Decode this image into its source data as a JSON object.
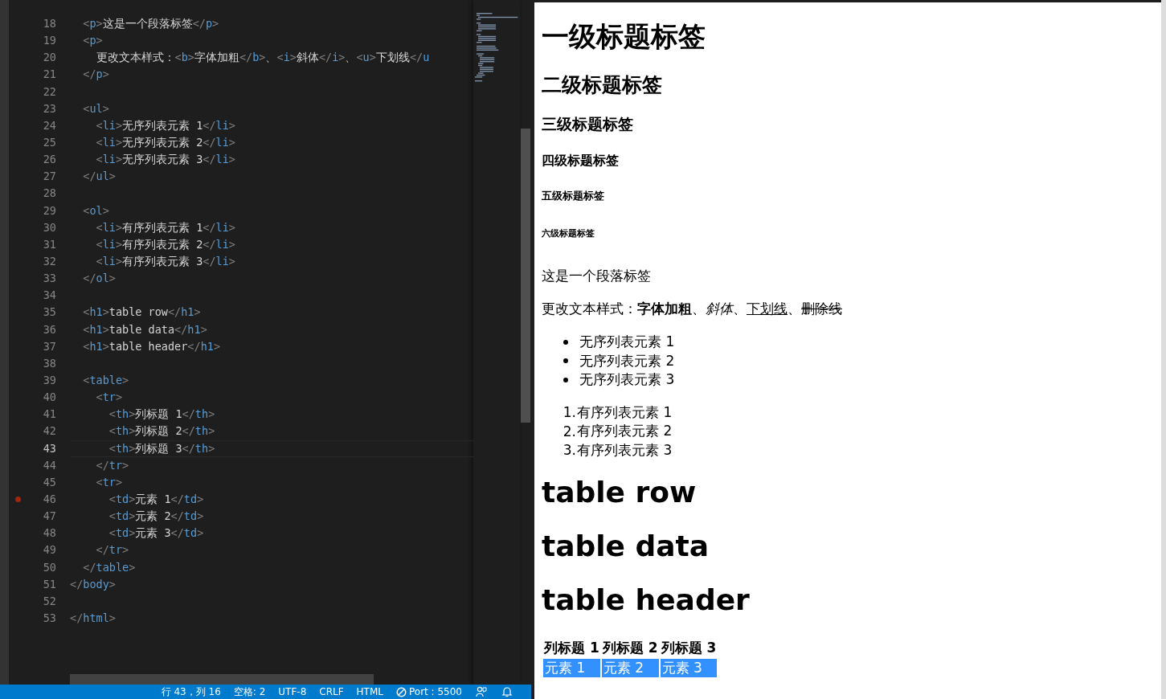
{
  "editor": {
    "lines": [
      {
        "number": "18",
        "code": "  <p>这是一个段落标签</p>",
        "current": false,
        "breakpoint": false
      },
      {
        "number": "19",
        "code": "  <p>",
        "current": false,
        "breakpoint": false
      },
      {
        "number": "20",
        "code": "    更改文本样式：<b>字体加粗</b>、<i>斜体</i>、<u>下划线</u",
        "current": false,
        "breakpoint": false
      },
      {
        "number": "21",
        "code": "  </p>",
        "current": false,
        "breakpoint": false
      },
      {
        "number": "22",
        "current": false,
        "breakpoint": false
      },
      {
        "number": "23",
        "code": "  <ul>",
        "current": false,
        "breakpoint": false
      },
      {
        "number": "24",
        "code": "    <li>无序列表元素 1</li>",
        "current": false,
        "breakpoint": false
      },
      {
        "number": "25",
        "code": "    <li>无序列表元素 2</li>",
        "current": false,
        "breakpoint": false
      },
      {
        "number": "26",
        "code": "    <li>无序列表元素 3</li>",
        "current": false,
        "breakpoint": false
      },
      {
        "number": "27",
        "code": "  </ul>",
        "current": false,
        "breakpoint": false
      },
      {
        "number": "28",
        "current": false,
        "breakpoint": false
      },
      {
        "number": "29",
        "code": "  <ol>",
        "current": false,
        "breakpoint": false
      },
      {
        "number": "30",
        "code": "    <li>有序列表元素 1</li>",
        "current": false,
        "breakpoint": false
      },
      {
        "number": "31",
        "code": "    <li>有序列表元素 2</li>",
        "current": false,
        "breakpoint": false
      },
      {
        "number": "32",
        "code": "    <li>有序列表元素 3</li>",
        "current": false,
        "breakpoint": false
      },
      {
        "number": "33",
        "code": "  </ol>",
        "current": false,
        "breakpoint": false
      },
      {
        "number": "34",
        "current": false,
        "breakpoint": false
      },
      {
        "number": "35",
        "code": "  <h1>table row</h1>",
        "current": false,
        "breakpoint": false
      },
      {
        "number": "36",
        "code": "  <h1>table data</h1>",
        "current": false,
        "breakpoint": false
      },
      {
        "number": "37",
        "code": "  <h1>table header</h1>",
        "current": false,
        "breakpoint": false
      },
      {
        "number": "38",
        "current": false,
        "breakpoint": false
      },
      {
        "number": "39",
        "code": "  <table>",
        "current": false,
        "breakpoint": false
      },
      {
        "number": "40",
        "code": "    <tr>",
        "current": false,
        "breakpoint": false
      },
      {
        "number": "41",
        "code": "      <th>列标题 1</th>",
        "current": false,
        "breakpoint": false
      },
      {
        "number": "42",
        "code": "      <th>列标题 2</th>",
        "current": false,
        "breakpoint": false
      },
      {
        "number": "43",
        "code": "      <th>列标题 3</th>",
        "current": true,
        "breakpoint": false
      },
      {
        "number": "44",
        "code": "    </tr>",
        "current": false,
        "breakpoint": false
      },
      {
        "number": "45",
        "code": "    <tr>",
        "current": false,
        "breakpoint": false
      },
      {
        "number": "46",
        "code": "      <td>元素 1</td>",
        "current": false,
        "breakpoint": true
      },
      {
        "number": "47",
        "code": "      <td>元素 2</td>",
        "current": false,
        "breakpoint": false
      },
      {
        "number": "48",
        "code": "      <td>元素 3</td>",
        "current": false,
        "breakpoint": false
      },
      {
        "number": "49",
        "code": "    </tr>",
        "current": false,
        "breakpoint": false
      },
      {
        "number": "50",
        "code": "  </table>",
        "current": false,
        "breakpoint": false
      },
      {
        "number": "51",
        "code": "</body>",
        "current": false,
        "breakpoint": false
      },
      {
        "number": "52",
        "current": false,
        "breakpoint": false
      },
      {
        "number": "53",
        "code": "</html>",
        "current": false,
        "breakpoint": false
      }
    ]
  },
  "status_bar": {
    "items": [
      {
        "kind": "text",
        "text": "行 43，列 16"
      },
      {
        "kind": "text",
        "text": "空格: 2"
      },
      {
        "kind": "text",
        "text": "UTF-8"
      },
      {
        "kind": "text",
        "text": "CRLF"
      },
      {
        "kind": "text",
        "text": "HTML"
      },
      {
        "kind": "port",
        "text": "Port : 5500"
      },
      {
        "kind": "feedback"
      },
      {
        "kind": "bell"
      }
    ]
  },
  "preview": {
    "blocks": [
      {
        "kind": "h1",
        "text": "一级标题标签"
      },
      {
        "kind": "h2",
        "text": "二级标题标签"
      },
      {
        "kind": "h3",
        "text": "三级标题标签"
      },
      {
        "kind": "h4",
        "text": "四级标题标签"
      },
      {
        "kind": "h5",
        "text": "五级标题标签"
      },
      {
        "kind": "h6",
        "text": "六级标题标签"
      },
      {
        "kind": "p",
        "text": "这是一个段落标签"
      },
      {
        "kind": "styled",
        "parts": [
          {
            "kind": "plain",
            "text": "更改文本样式："
          },
          {
            "kind": "bold",
            "text": "字体加粗"
          },
          {
            "kind": "plain",
            "text": "、"
          },
          {
            "kind": "italic",
            "text": "斜体"
          },
          {
            "kind": "plain",
            "text": "、"
          },
          {
            "kind": "underline",
            "text": "下划线"
          },
          {
            "kind": "plain",
            "text": "、"
          },
          {
            "kind": "strike",
            "text": "删除线"
          }
        ]
      },
      {
        "kind": "ul",
        "items": [
          "无序列表元素 1",
          "无序列表元素 2",
          "无序列表元素 3"
        ]
      },
      {
        "kind": "ol",
        "items": [
          {
            "marker": "1.",
            "text": "有序列表元素 1"
          },
          {
            "marker": "2.",
            "text": "有序列表元素 2"
          },
          {
            "marker": "3.",
            "text": "有序列表元素 3"
          }
        ]
      },
      {
        "kind": "h1big",
        "text": "table row"
      },
      {
        "kind": "h1big",
        "text": "table data"
      },
      {
        "kind": "h1big",
        "text": "table header"
      },
      {
        "kind": "table",
        "header": [
          "列标题 1",
          "列标题 2",
          "列标题 3"
        ],
        "cells": [
          {
            "text": "元素 1",
            "selected": true
          },
          {
            "text": "元素 2",
            "selected": true
          },
          {
            "text": "元素 3",
            "selected": true
          }
        ]
      }
    ]
  }
}
